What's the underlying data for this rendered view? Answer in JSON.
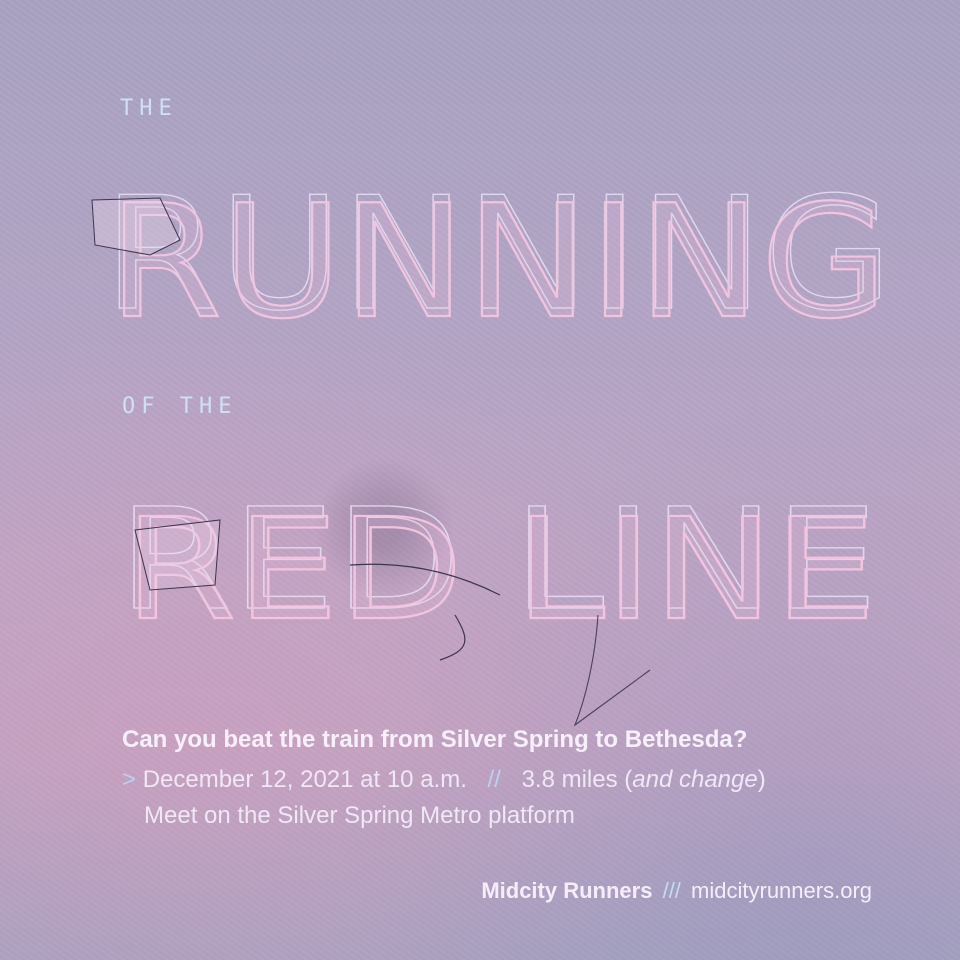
{
  "poster": {
    "kicker_1": "THE",
    "title_1": "RUNNING",
    "kicker_2": "OF THE",
    "title_2": "RED LINE",
    "question": "Can you beat the train from Silver Spring to Bethesda?",
    "marker": ">",
    "date": "December 12, 2021 at 10 a.m.",
    "separator": "//",
    "distance": "3.8 miles (",
    "distance_note": "and change",
    "distance_close": ")",
    "meeting": "Meet on the Silver Spring Metro platform"
  },
  "footer": {
    "organization": "Midcity Runners",
    "separator": "///",
    "website": "midcityrunners.org"
  },
  "colors": {
    "background_top": "#a9a3c2",
    "background_bottom": "#c2a5c3",
    "lettering": "#f1c4e0",
    "accent_blue": "#b9d2f2",
    "text_light": "#f4ecf8"
  }
}
